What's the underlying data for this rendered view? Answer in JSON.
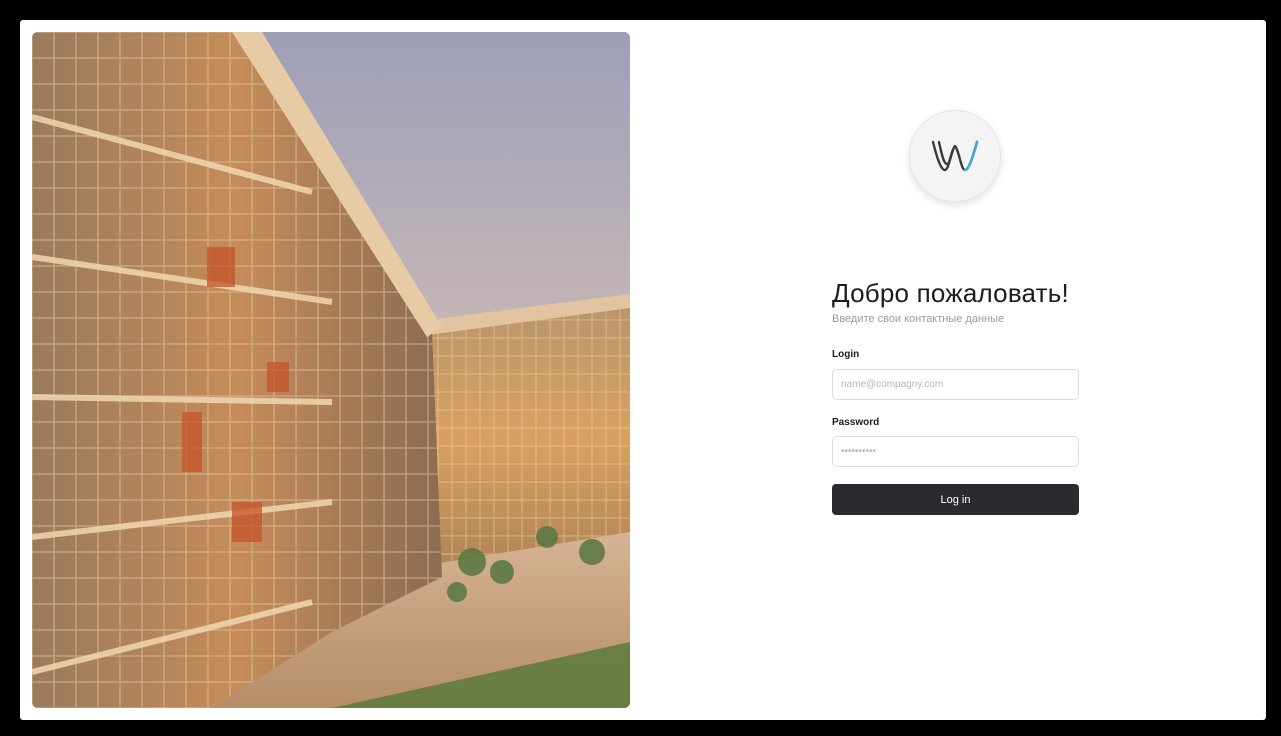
{
  "login_page": {
    "logo_icon": "w-logo-icon",
    "title": "Добро пожаловать!",
    "subtitle": "Введите свои контактные данные",
    "login": {
      "label": "Login",
      "placeholder": "name@compagny.com",
      "value": ""
    },
    "password": {
      "label": "Password",
      "placeholder": "••••••••••",
      "value": ""
    },
    "submit_label": "Log in"
  },
  "hero_image": {
    "subject": "building-atrium-photo"
  },
  "colors": {
    "button_bg": "#2b2b2f",
    "logo_accent": "#4aa3d8",
    "logo_dark": "#3a3a3e"
  }
}
